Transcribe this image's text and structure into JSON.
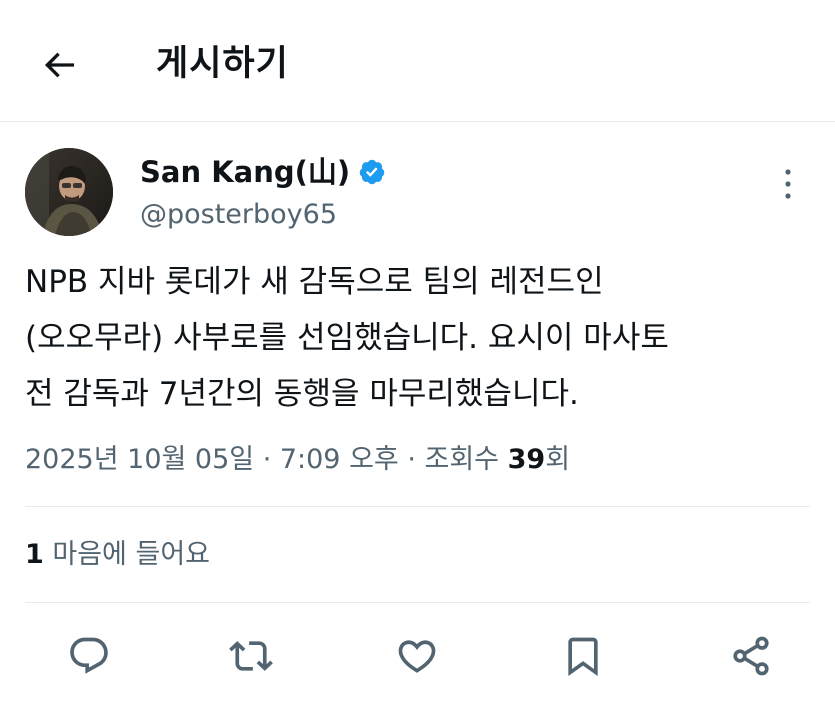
{
  "header": {
    "back_icon": "arrow-left-icon",
    "title": "게시하기"
  },
  "author": {
    "name": "San Kang(山)",
    "handle": "@posterboy65",
    "verified": true,
    "verified_color": "#1d9bf0",
    "avatar_icon": "avatar"
  },
  "post": {
    "text_lines": [
      "NPB 지바 롯데가 새 감독으로 팀의 레전드인",
      "(오오무라) 사부로를 선임했습니다. 요시이 마사토",
      "전 감독과 7년간의 동행을 마무리했습니다."
    ],
    "timestamp": "2025년 10월 05일 · 7:09 오후 · 조회수 ",
    "views": "39",
    "views_suffix": "회"
  },
  "engagement": {
    "likes_count": "1",
    "likes_label": " 마음에 들어요"
  },
  "actions": [
    {
      "icon": "reply-icon"
    },
    {
      "icon": "repost-icon"
    },
    {
      "icon": "like-icon"
    },
    {
      "icon": "bookmark-icon"
    },
    {
      "icon": "share-icon"
    }
  ],
  "colors": {
    "text_primary": "#0f1419",
    "text_secondary": "#536471",
    "divider": "#e7e9ea",
    "verified": "#1d9bf0"
  }
}
